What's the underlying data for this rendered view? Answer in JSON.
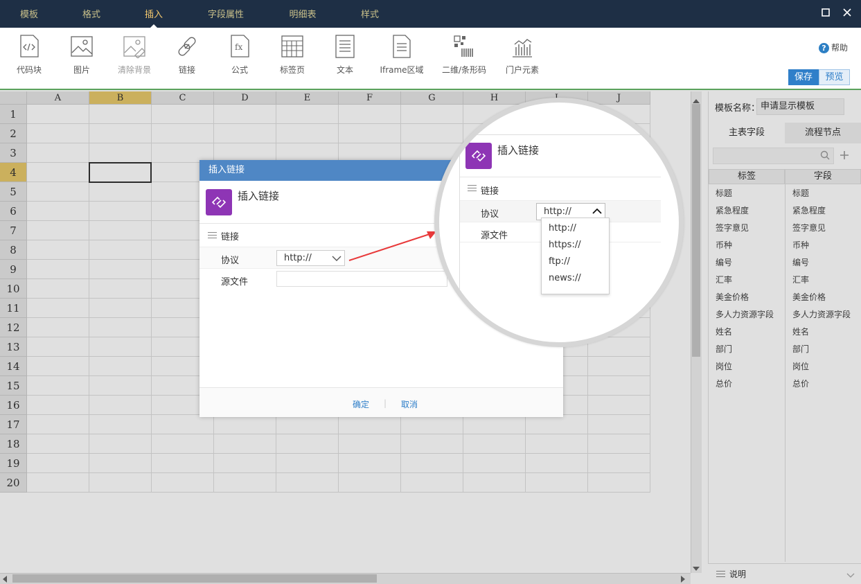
{
  "menu": {
    "tabs": [
      {
        "label": "模板"
      },
      {
        "label": "格式"
      },
      {
        "label": "插入"
      },
      {
        "label": "字段属性"
      },
      {
        "label": "明细表"
      },
      {
        "label": "样式"
      }
    ],
    "active_tab": "插入"
  },
  "toolbar": {
    "tools": [
      {
        "label": "代码块",
        "icon": "code-block-icon"
      },
      {
        "label": "图片",
        "icon": "image-icon"
      },
      {
        "label": "清除背景",
        "icon": "clear-background-icon",
        "disabled": true
      },
      {
        "label": "链接",
        "icon": "link-icon"
      },
      {
        "label": "公式",
        "icon": "formula-icon"
      },
      {
        "label": "标签页",
        "icon": "tab-page-icon"
      },
      {
        "label": "文本",
        "icon": "text-icon"
      },
      {
        "label": "Iframe区域",
        "icon": "iframe-icon"
      },
      {
        "label": "二维/条形码",
        "icon": "barcode-icon"
      },
      {
        "label": "门户元素",
        "icon": "portal-element-icon"
      }
    ],
    "help_label": "帮助",
    "save_label": "保存",
    "preview_label": "预览"
  },
  "sheet": {
    "columns": [
      "A",
      "B",
      "C",
      "D",
      "E",
      "F",
      "G",
      "H",
      "I",
      "J"
    ],
    "rows": [
      "1",
      "2",
      "3",
      "4",
      "5",
      "6",
      "7",
      "8",
      "9",
      "10",
      "11",
      "12",
      "13",
      "14",
      "15",
      "16",
      "17",
      "18",
      "19",
      "20"
    ],
    "selected_column": "B",
    "selected_row": "4"
  },
  "right_panel": {
    "template_name_label": "模板名称：",
    "template_name": "申请显示模板",
    "tabs": [
      "主表字段",
      "流程节点"
    ],
    "col_label": "标签",
    "col_field": "字段",
    "fields": [
      {
        "label": "标题",
        "field": "标题"
      },
      {
        "label": "紧急程度",
        "field": "紧急程度"
      },
      {
        "label": "签字意见",
        "field": "签字意见"
      },
      {
        "label": "币种",
        "field": "币种"
      },
      {
        "label": "编号",
        "field": "编号"
      },
      {
        "label": "汇率",
        "field": "汇率"
      },
      {
        "label": "美金价格",
        "field": "美金价格"
      },
      {
        "label": "多人力资源字段",
        "field": "多人力资源字段"
      },
      {
        "label": "姓名",
        "field": "姓名"
      },
      {
        "label": "部门",
        "field": "部门"
      },
      {
        "label": "岗位",
        "field": "岗位"
      },
      {
        "label": "总价",
        "field": "总价"
      }
    ],
    "footer_label": "说明"
  },
  "dialog": {
    "title": "插入链接",
    "heading": "插入链接",
    "section": "链接",
    "protocol_label": "协议",
    "protocol_value": "http://",
    "source_label": "源文件",
    "ok_label": "确定",
    "cancel_label": "取消"
  },
  "magnifier": {
    "heading": "插入链接",
    "section": "链接",
    "protocol_label": "协议",
    "protocol_value": "http://",
    "source_label": "源文件",
    "options": [
      "http://",
      "https://",
      "ftp://",
      "news://"
    ]
  },
  "colors": {
    "topbar": "#1e2f45",
    "dialog_title": "#4f87c5",
    "app_icon": "#8e35b5",
    "save_button": "#2f7fc9",
    "selected_header": "#e8c96a",
    "arrow": "#e8393a"
  }
}
